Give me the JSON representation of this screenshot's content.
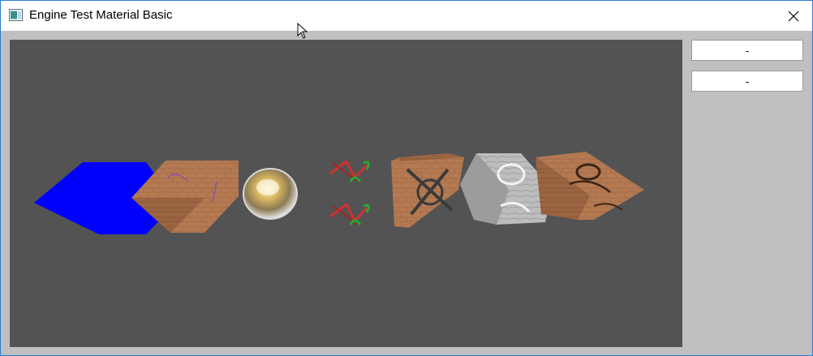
{
  "window": {
    "title": "Engine Test Material Basic",
    "icons": {
      "app": "app-window-icon",
      "close": "close-icon",
      "cursor": "mouse-cursor-icon"
    }
  },
  "scene": {
    "background_color": "#535353",
    "objects": [
      "blue-hexagon",
      "wood-cube",
      "chrome-sphere",
      "graffiti-sprite-top",
      "graffiti-sprite-bottom",
      "painted-wood-cube",
      "marble-cube",
      "wood-rune-cube"
    ]
  },
  "side_panel": {
    "button_1_label": "-",
    "button_2_label": "-"
  },
  "colors": {
    "accent_border": "#2b7cd3",
    "hexagon": "#0000ff",
    "wood": "#b57a52"
  }
}
